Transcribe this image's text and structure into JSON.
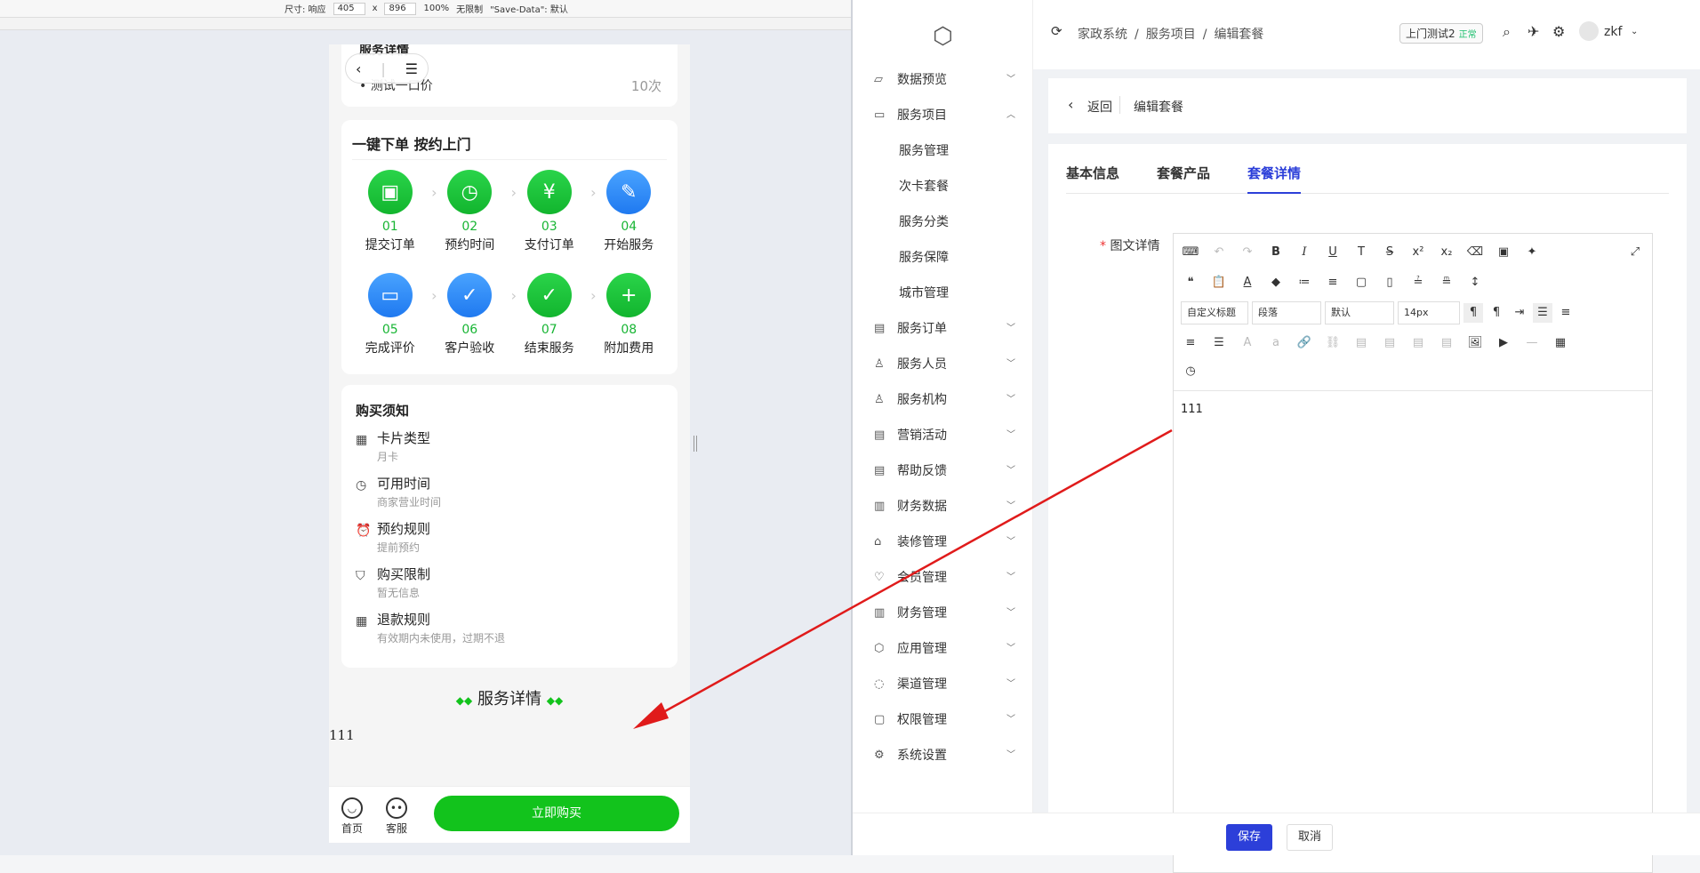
{
  "devtools": {
    "size_label": "尺寸: 响应",
    "width": "405",
    "x": "x",
    "height": "896",
    "zoom": "100%",
    "throttle": "无限制",
    "savedata": "\"Save-Data\": 默认"
  },
  "phone": {
    "top": {
      "cut_title": "服务详情",
      "item_label": "测试一口价",
      "item_count": "10次"
    },
    "steps_title": "一键下单 按约上门",
    "steps": [
      {
        "num": "01",
        "label": "提交订单",
        "color": "green",
        "icon": "bag-icon"
      },
      {
        "num": "02",
        "label": "预约时间",
        "color": "green",
        "icon": "clock-icon"
      },
      {
        "num": "03",
        "label": "支付订单",
        "color": "green",
        "icon": "pay-icon"
      },
      {
        "num": "04",
        "label": "开始服务",
        "color": "blue",
        "icon": "worker-icon"
      },
      {
        "num": "05",
        "label": "完成评价",
        "color": "blue",
        "icon": "comment-icon"
      },
      {
        "num": "06",
        "label": "客户验收",
        "color": "blue",
        "icon": "shield-check-icon"
      },
      {
        "num": "07",
        "label": "结束服务",
        "color": "green",
        "icon": "check-icon"
      },
      {
        "num": "08",
        "label": "附加费用",
        "color": "green",
        "icon": "add-fee-icon"
      }
    ],
    "notice_title": "购买须知",
    "notice": [
      {
        "t": "卡片类型",
        "v": "月卡",
        "icon": "calendar-icon"
      },
      {
        "t": "可用时间",
        "v": "商家营业时间",
        "icon": "clock-icon"
      },
      {
        "t": "预约规则",
        "v": "提前预约",
        "icon": "alarm-icon"
      },
      {
        "t": "购买限制",
        "v": "暂无信息",
        "icon": "shield-icon"
      },
      {
        "t": "退款规则",
        "v": "有效期内未使用，过期不退",
        "icon": "calendar-icon"
      }
    ],
    "detail_title": "服务详情",
    "detail_body": "111",
    "bottom": {
      "home": "首页",
      "service": "客服",
      "buy": "立即购买"
    }
  },
  "admin": {
    "breadcrumb": [
      "家政系统",
      "/",
      "服务项目",
      "/",
      "编辑套餐"
    ],
    "tag": {
      "label": "上门测试2",
      "status": "正常"
    },
    "user": "zkf",
    "menu": [
      {
        "label": "数据预览",
        "icon": "chart-icon",
        "open": false
      },
      {
        "label": "服务项目",
        "icon": "box-icon",
        "open": true,
        "children": [
          "服务管理",
          "次卡套餐",
          "服务分类",
          "服务保障",
          "城市管理"
        ]
      },
      {
        "label": "服务订单",
        "icon": "order-icon",
        "open": false
      },
      {
        "label": "服务人员",
        "icon": "user-icon",
        "open": false
      },
      {
        "label": "服务机构",
        "icon": "org-icon",
        "open": false
      },
      {
        "label": "营销活动",
        "icon": "promo-icon",
        "open": false
      },
      {
        "label": "帮助反馈",
        "icon": "help-icon",
        "open": false
      },
      {
        "label": "财务数据",
        "icon": "finance-icon",
        "open": false
      },
      {
        "label": "装修管理",
        "icon": "decor-icon",
        "open": false
      },
      {
        "label": "会员管理",
        "icon": "member-icon",
        "open": false
      },
      {
        "label": "财务管理",
        "icon": "wallet-icon",
        "open": false
      },
      {
        "label": "应用管理",
        "icon": "app-icon",
        "open": false
      },
      {
        "label": "渠道管理",
        "icon": "channel-icon",
        "open": false
      },
      {
        "label": "权限管理",
        "icon": "lock-icon",
        "open": false
      },
      {
        "label": "系统设置",
        "icon": "gear-icon",
        "open": false
      }
    ],
    "back": "返回",
    "page_title": "编辑套餐",
    "tabs": [
      "基本信息",
      "套餐产品",
      "套餐详情"
    ],
    "active_tab": 2,
    "field_label": "图文详情",
    "editor": {
      "font_family": "自定义标题",
      "block": "段落",
      "font_default": "默认",
      "font_size": "14px",
      "content": "111"
    },
    "save": "保存",
    "cancel": "取消",
    "accent": "#2c3fd9",
    "arrow_color": "#e01b1b"
  }
}
